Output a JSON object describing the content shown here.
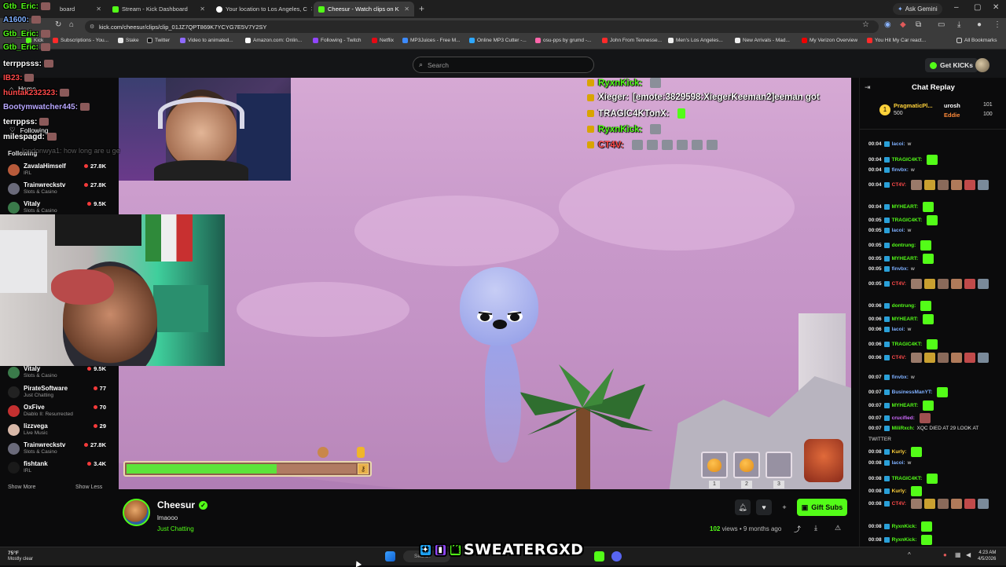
{
  "browser": {
    "tabs": [
      {
        "label": "board",
        "color": "#53fc18"
      },
      {
        "label": "Stream - Kick Dashboard",
        "color": "#53fc18"
      },
      {
        "label": "Your location to Los Angeles, C",
        "color": "#ffffff"
      },
      {
        "label": "Cheesur - Watch clips on K",
        "color": "#53fc18"
      }
    ],
    "ask_gemini": "Ask Gemini",
    "url": "kick.com/cheesur/clips/clip_01JZ7QPT869K7YCYG7E5V7Y2SY",
    "bookmarks": [
      {
        "label": "Kick"
      },
      {
        "label": "Subscriptions - You..."
      },
      {
        "label": "Stake"
      },
      {
        "label": "Twitter"
      },
      {
        "label": "Video to animated..."
      },
      {
        "label": "Amazon.com: Onlin..."
      },
      {
        "label": "Following - Twitch"
      },
      {
        "label": "Netflix"
      },
      {
        "label": "MP3Juices - Free M..."
      },
      {
        "label": "Online MP3 Cutter -..."
      },
      {
        "label": "osu-pps by grumd -..."
      },
      {
        "label": "John From Tennesse..."
      },
      {
        "label": "Men's Los Angeles..."
      },
      {
        "label": "New Arrivals - Mad..."
      },
      {
        "label": "My Verizon Overview"
      },
      {
        "label": "You Hit My Car react..."
      },
      {
        "label": "All Bookmarks"
      }
    ]
  },
  "kick": {
    "search_placeholder": "Search",
    "get_kicks": "Get KICKs"
  },
  "sidebar": {
    "nav": [
      {
        "label": "Home"
      },
      {
        "label": "Following"
      }
    ],
    "following_title": "Following",
    "items": [
      {
        "name": "ZavalaHimself",
        "category": "IRL",
        "count": "27.8K",
        "color": "#b85a3a"
      },
      {
        "name": "Trainwreckstv",
        "category": "Slots & Casino",
        "count": "27.8K",
        "color": "#6a6a7a"
      },
      {
        "name": "Vitaly",
        "category": "Slots & Casino",
        "count": "9.5K",
        "color": "#3a7a4a"
      },
      {
        "name": "Vitaly",
        "category": "Slots & Casino",
        "count": "9.5K",
        "color": "#3a7a4a"
      },
      {
        "name": "PirateSoftware",
        "category": "Just Chatting",
        "count": "77",
        "color": "#222222"
      },
      {
        "name": "OxFive",
        "category": "Diablo II: Resurrected",
        "count": "70",
        "color": "#c43030"
      },
      {
        "name": "lizzvega",
        "category": "Live Music",
        "count": "29",
        "color": "#d8b8a8"
      },
      {
        "name": "Trainwreckstv",
        "category": "Slots & Casino",
        "count": "27.8K",
        "color": "#6a6a7a"
      },
      {
        "name": "fishtank",
        "category": "IRL",
        "count": "3.4K",
        "color": "#1a1a1a"
      }
    ],
    "show_more": "Show More",
    "show_less": "Show Less"
  },
  "left_overlay": [
    {
      "text": "Gtb_Eric:",
      "color": "#53fc18"
    },
    {
      "text": "A1600:",
      "color": "#7fb0ff"
    },
    {
      "text": "Gtb_Eric:",
      "color": "#53fc18"
    },
    {
      "text": "Gtb_Eric:",
      "color": "#53fc18"
    },
    {
      "text": "terrppsss:",
      "color": "#ffffff"
    },
    {
      "text": "IB23:",
      "color": "#ff4a4a"
    },
    {
      "text": "huntak232323:",
      "color": "#ff4a4a"
    },
    {
      "text": "Bootymwatcher445:",
      "color": "#b8a7ff"
    },
    {
      "text": "terrppss:",
      "color": "#ffffff"
    },
    {
      "text": "milespagd:",
      "color": "#ffffff"
    },
    {
      "text": "londonwya1: how long are u ge",
      "color": "#9a9a9a"
    }
  ],
  "video_overlay_chat": [
    {
      "user": "RyxnKick:",
      "msg": "",
      "color": "#53fc18"
    },
    {
      "user": "Xieger:",
      "msg": "[emote:3829598:XiegerKeeman2]eeman got",
      "color": "#ffffff"
    },
    {
      "user": "TRAGIC4KTonX:",
      "msg": "",
      "color": "#ffffff"
    },
    {
      "user": "RyxnKick:",
      "msg": "",
      "color": "#53fc18"
    },
    {
      "user": "CT4V:",
      "msg": "",
      "color": "#ff4a4a"
    }
  ],
  "game_hud": {
    "health_fraction": 0.62,
    "slots": [
      "1",
      "2",
      "3"
    ]
  },
  "clip": {
    "streamer": "Cheesur",
    "title": "lmaooo",
    "category": "Just Chatting",
    "gift_subs": "Gift Subs",
    "views_count": "102",
    "views_rest": "views • 9 months ago"
  },
  "chat": {
    "title": "Chat Replay",
    "pinned": {
      "user1": "PragmaticPl...",
      "amt1": "500",
      "user2": "urosh",
      "amt2": "101",
      "user3": "Eddie",
      "amt3": "100"
    },
    "lines": [
      {
        "ts": "00:04",
        "user": "lacoi:",
        "msg": "w",
        "color": "#7fb0ff"
      },
      {
        "ts": "00:04",
        "user": "TRAGIC4KT:",
        "msg": "",
        "color": "#53fc18"
      },
      {
        "ts": "00:04",
        "user": "finvbx:",
        "msg": "w",
        "color": "#7fb0ff"
      },
      {
        "ts": "00:04",
        "user": "CT4V:",
        "msg": "",
        "color": "#ff4a4a"
      },
      {
        "ts": "00:04",
        "user": "MYHEART:",
        "msg": "",
        "color": "#53fc18"
      },
      {
        "ts": "00:05",
        "user": "TRAGIC4KT:",
        "msg": "",
        "color": "#53fc18"
      },
      {
        "ts": "00:05",
        "user": "lacoi:",
        "msg": "w",
        "color": "#7fb0ff"
      },
      {
        "ts": "00:05",
        "user": "dontrung:",
        "msg": "",
        "color": "#53fc18"
      },
      {
        "ts": "00:05",
        "user": "MYHEART:",
        "msg": "",
        "color": "#53fc18"
      },
      {
        "ts": "00:05",
        "user": "finvbx:",
        "msg": "w",
        "color": "#7fb0ff"
      },
      {
        "ts": "00:05",
        "user": "CT4V:",
        "msg": "",
        "color": "#ff4a4a"
      },
      {
        "ts": "00:06",
        "user": "dontrung:",
        "msg": "",
        "color": "#53fc18"
      },
      {
        "ts": "00:06",
        "user": "MYHEART:",
        "msg": "",
        "color": "#53fc18"
      },
      {
        "ts": "00:06",
        "user": "lacoi:",
        "msg": "w",
        "color": "#7fb0ff"
      },
      {
        "ts": "00:06",
        "user": "TRAGIC4KT:",
        "msg": "",
        "color": "#53fc18"
      },
      {
        "ts": "00:06",
        "user": "CT4V:",
        "msg": "",
        "color": "#ff4a4a"
      },
      {
        "ts": "00:07",
        "user": "finvbx:",
        "msg": "w",
        "color": "#7fb0ff"
      },
      {
        "ts": "00:07",
        "user": "BusinessManYT:",
        "msg": "",
        "color": "#7fb0ff"
      },
      {
        "ts": "00:07",
        "user": "MYHEART:",
        "msg": "",
        "color": "#53fc18"
      },
      {
        "ts": "00:07",
        "user": "crucified:",
        "msg": "",
        "color": "#d06bff"
      },
      {
        "ts": "00:07",
        "user": "MiliRxch:",
        "msg": "XQC DIED AT 29 LOOK AT",
        "color": "#53fc18"
      },
      {
        "ts": "00:08",
        "user": "Kurly:",
        "msg": "",
        "color": "#ffd23a"
      },
      {
        "ts": "00:08",
        "user": "lacoi:",
        "msg": "w",
        "color": "#7fb0ff"
      },
      {
        "ts": "00:08",
        "user": "TRAGIC4KT:",
        "msg": "",
        "color": "#53fc18"
      },
      {
        "ts": "00:08",
        "user": "Kurly:",
        "msg": "",
        "color": "#ffd23a"
      },
      {
        "ts": "00:08",
        "user": "CT4V:",
        "msg": "",
        "color": "#ff4a4a"
      },
      {
        "ts": "00:08",
        "user": "RyxnKick:",
        "msg": "",
        "color": "#53fc18"
      },
      {
        "ts": "00:08",
        "user": "RyxnKick:",
        "msg": "",
        "color": "#53fc18"
      }
    ],
    "twitter_cont": "TWITTER"
  },
  "taskbar": {
    "temp": "75°F",
    "condition": "Mostly clear",
    "search": "Search",
    "time": "4:23 AM",
    "date": "4/5/2026"
  },
  "branding": "SWEATERGXD",
  "colors": {
    "kick_green": "#53fc18",
    "bg": "#0b0b0c"
  }
}
